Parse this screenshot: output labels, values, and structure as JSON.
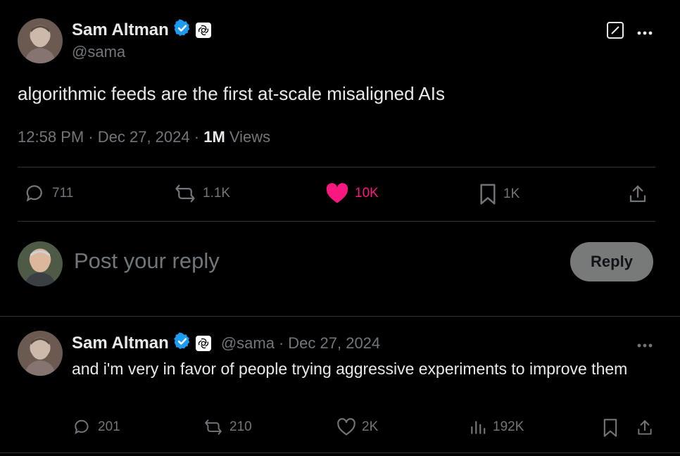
{
  "main_tweet": {
    "author_name": "Sam Altman",
    "author_handle": "@sama",
    "text": "algorithmic feeds are the first at-scale misaligned AIs",
    "time": "12:58 PM",
    "sep1": "·",
    "date": "Dec 27, 2024",
    "sep2": "·",
    "views_count": "1M",
    "views_label": "Views",
    "actions": {
      "replies": "711",
      "reposts": "1.1K",
      "likes": "10K",
      "bookmarks": "1K"
    }
  },
  "reply_composer": {
    "placeholder": "Post your reply",
    "button_label": "Reply"
  },
  "reply_tweet": {
    "author_name": "Sam Altman",
    "author_handle": "@sama",
    "separator": "·",
    "date": "Dec 27, 2024",
    "text": "and i'm very in favor of people trying aggressive experiments to improve them",
    "actions": {
      "replies": "201",
      "reposts": "210",
      "likes": "2K",
      "views": "192K"
    }
  },
  "colors": {
    "verified": "#1d9bf0",
    "like_active": "#f91880",
    "muted": "#71767b",
    "text": "#e7e9ea",
    "reply_button_bg": "#787a7a"
  },
  "icons": [
    "verified-badge-icon",
    "openai-badge-icon",
    "grok-icon",
    "more-icon",
    "reply-icon",
    "repost-icon",
    "like-icon",
    "bookmark-icon",
    "share-icon",
    "views-icon"
  ]
}
